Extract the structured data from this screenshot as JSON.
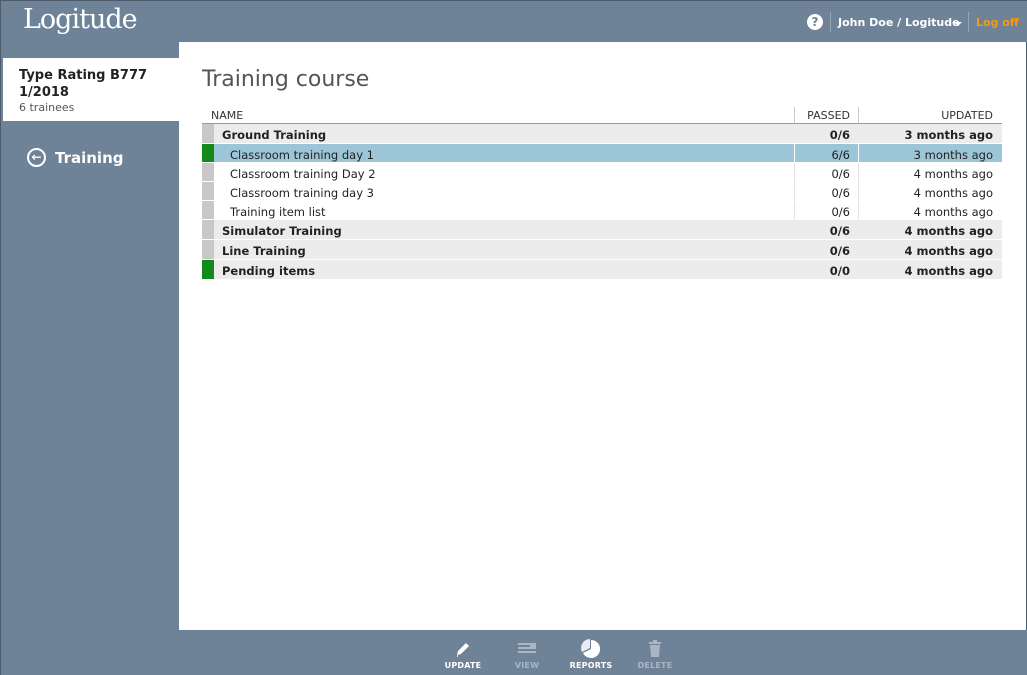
{
  "app": {
    "logo": "Logitude",
    "help_icon": "question-circle-icon",
    "user": "John Doe / Logitude",
    "logoff": "Log off",
    "accent_color": "#f39c12"
  },
  "sidebar": {
    "course_title": "Type Rating B777 1/2018",
    "course_subtitle": "6 trainees",
    "back_icon": "arrow-left-circle-icon",
    "back_label": "Training"
  },
  "main": {
    "title": "Training course",
    "columns": {
      "name": "NAME",
      "passed": "PASSED",
      "updated": "UPDATED"
    },
    "rows": [
      {
        "name": "Ground Training",
        "passed": "0/6",
        "updated": "3 months ago"
      },
      {
        "name": "Classroom training day 1",
        "passed": "6/6",
        "updated": "3 months ago"
      },
      {
        "name": "Classroom training Day 2",
        "passed": "0/6",
        "updated": "4 months ago"
      },
      {
        "name": "Classroom training day 3",
        "passed": "0/6",
        "updated": "4 months ago"
      },
      {
        "name": "Training item list",
        "passed": "0/6",
        "updated": "4 months ago"
      },
      {
        "name": "Simulator Training",
        "passed": "0/6",
        "updated": "4 months ago"
      },
      {
        "name": "Line Training",
        "passed": "0/6",
        "updated": "4 months ago"
      },
      {
        "name": "Pending items",
        "passed": "0/0",
        "updated": "4 months ago"
      }
    ]
  },
  "toolbar": {
    "update": "UPDATE",
    "view": "VIEW",
    "reports": "REPORTS",
    "delete": "DELETE"
  }
}
